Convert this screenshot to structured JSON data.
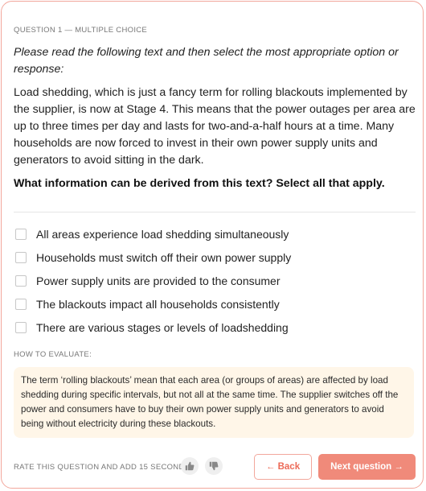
{
  "question": {
    "label": "QUESTION 1 — MULTIPLE CHOICE",
    "instruction": "Please read the following text and then select the most appropriate option or response:",
    "passage": "Load shedding, which is just a fancy term for rolling blackouts implemented by the supplier, is now at Stage 4. This means that the power outages per area are up to three times per day and lasts for two-and-a-half hours at a time. Many households are now forced to invest in their own power supply units and generators to avoid sitting in the dark.",
    "prompt": "What information can be derived from this text? Select all that apply."
  },
  "options": [
    {
      "label": "All areas experience load shedding simultaneously",
      "checked": false
    },
    {
      "label": "Households must switch off their own power supply",
      "checked": false
    },
    {
      "label": "Power supply units are provided to the consumer",
      "checked": false
    },
    {
      "label": "The blackouts impact all households consistently",
      "checked": false
    },
    {
      "label": "There are various stages or levels of loadshedding",
      "checked": false
    }
  ],
  "evaluation": {
    "label": "HOW TO EVALUATE:",
    "text": "The term ‘rolling blackouts’ mean that each area (or groups of areas) are affected by load shedding during specific intervals, but not all at the same time. The supplier switches off the power and consumers have to buy their own power supply units and generators to avoid being without electricity during these blackouts."
  },
  "footer": {
    "rate_label": "RATE THIS QUESTION AND ADD 15 SECONDS:",
    "thumb_up_icon": "thumbs-up-icon",
    "thumb_down_icon": "thumbs-down-icon",
    "back_label": "← Back",
    "next_label": "Next question →"
  },
  "colors": {
    "accent": "#f08a7a",
    "border": "#f2a79c",
    "eval_bg": "#fff6e8"
  }
}
